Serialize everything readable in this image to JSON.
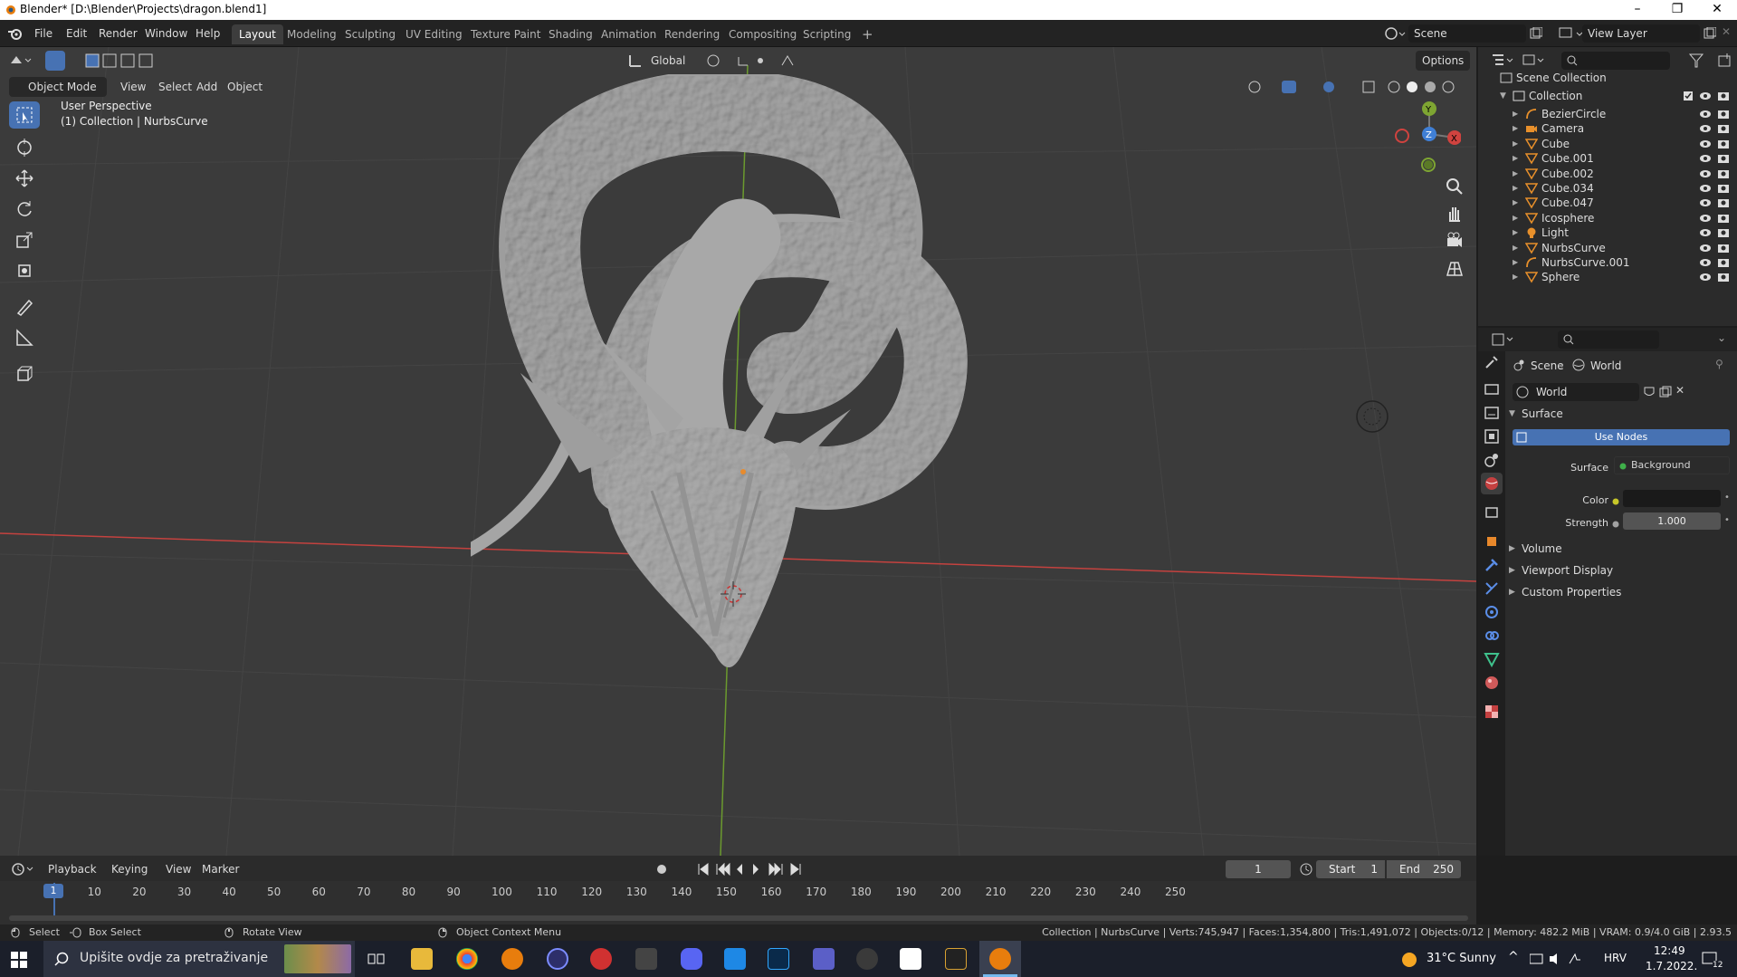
{
  "window": {
    "title": "Blender* [D:\\Blender\\Projects\\dragon.blend1]"
  },
  "menus": [
    "File",
    "Edit",
    "Render",
    "Window",
    "Help"
  ],
  "workspaces": [
    "Layout",
    "Modeling",
    "Sculpting",
    "UV Editing",
    "Texture Paint",
    "Shading",
    "Animation",
    "Rendering",
    "Compositing",
    "Scripting"
  ],
  "workspace_add": "+",
  "scene_field": "Scene",
  "view_layer_field": "View Layer",
  "viewport": {
    "mode": "Object Mode",
    "header_menus": [
      "View",
      "Select",
      "Add",
      "Object"
    ],
    "transform_orientation": "Global",
    "options_label": "Options",
    "overlay_line1": "User Perspective",
    "overlay_line2": "(1) Collection | NurbsCurve",
    "gizmo": {
      "y": "Y",
      "z": "Z",
      "x": "X"
    }
  },
  "outliner": {
    "root": "Scene Collection",
    "collection": "Collection",
    "items": [
      {
        "name": "BezierCircle",
        "icon": "curve-icon"
      },
      {
        "name": "Camera",
        "icon": "camera-icon"
      },
      {
        "name": "Cube",
        "icon": "mesh-icon"
      },
      {
        "name": "Cube.001",
        "icon": "mesh-icon"
      },
      {
        "name": "Cube.002",
        "icon": "mesh-icon"
      },
      {
        "name": "Cube.034",
        "icon": "mesh-icon"
      },
      {
        "name": "Cube.047",
        "icon": "mesh-icon"
      },
      {
        "name": "Icosphere",
        "icon": "mesh-icon"
      },
      {
        "name": "Light",
        "icon": "light-icon"
      },
      {
        "name": "NurbsCurve",
        "icon": "mesh-icon"
      },
      {
        "name": "NurbsCurve.001",
        "icon": "curve-icon"
      },
      {
        "name": "Sphere",
        "icon": "mesh-icon"
      }
    ]
  },
  "properties": {
    "breadcrumb_scene": "Scene",
    "breadcrumb_world": "World",
    "world_name": "World",
    "surface_panel": "Surface",
    "use_nodes": "Use Nodes",
    "surface_label": "Surface",
    "surface_value": "Background",
    "color_label": "Color",
    "strength_label": "Strength",
    "strength_value": "1.000",
    "panels": [
      "Volume",
      "Viewport Display",
      "Custom Properties"
    ]
  },
  "timeline": {
    "menus": [
      "Playback",
      "Keying",
      "View",
      "Marker"
    ],
    "current_frame": "1",
    "start_label": "Start",
    "start_value": "1",
    "end_label": "End",
    "end_value": "250",
    "ticks": [
      "10",
      "20",
      "30",
      "40",
      "50",
      "60",
      "70",
      "80",
      "90",
      "100",
      "110",
      "120",
      "130",
      "140",
      "150",
      "160",
      "170",
      "180",
      "190",
      "200",
      "210",
      "220",
      "230",
      "240",
      "250"
    ],
    "playhead": "1"
  },
  "status": {
    "select": "Select",
    "box_select": "Box Select",
    "rotate_view": "Rotate View",
    "context_menu": "Object Context Menu",
    "stats": "Collection | NurbsCurve | Verts:745,947 | Faces:1,354,800 | Tris:1,491,072 | Objects:0/12 | Memory: 482.2 MiB | VRAM: 0.9/4.0 GiB | 2.93.5"
  },
  "taskbar": {
    "search_placeholder": "Upišite ovdje za pretraživanje",
    "weather": "31°C  Sunny",
    "lang": "HRV",
    "time": "12:49",
    "date": "1.7.2022.",
    "notif_count": "12"
  },
  "colors": {
    "accent_blue": "#4772b3",
    "x_axis": "#d0433f",
    "y_axis": "#7ea532",
    "z_axis": "#3f7fd6",
    "viewport_bg": "#3b3b3b"
  }
}
